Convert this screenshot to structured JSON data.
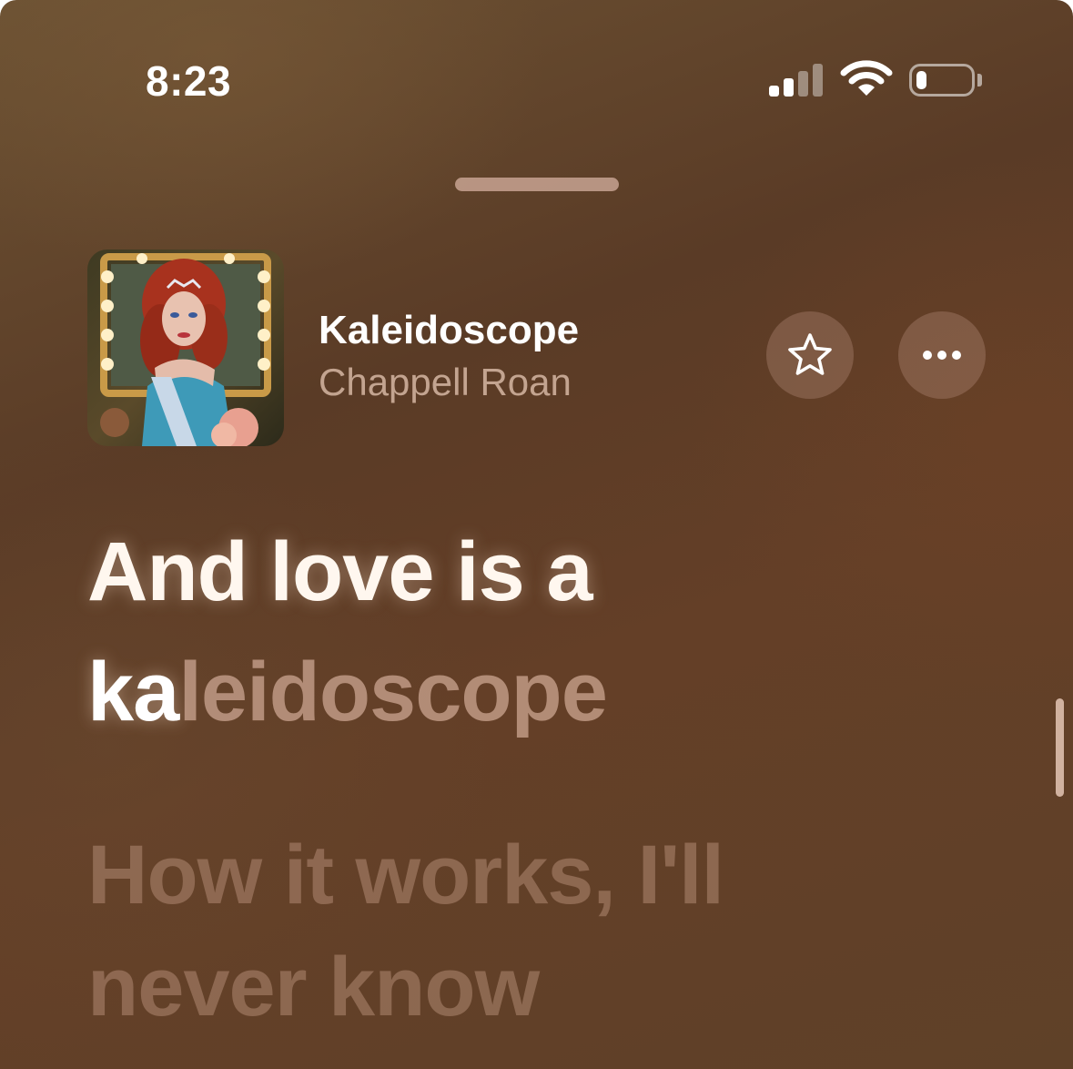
{
  "status_bar": {
    "time": "8:23",
    "signal_bars_active": 2,
    "signal_bars_total": 4,
    "wifi_icon": "wifi-icon",
    "battery_level": 0.2
  },
  "now_playing": {
    "title": "Kaleidoscope",
    "artist": "Chappell Roan",
    "artwork_icon": "album-artwork",
    "favorite_icon": "star-outline-icon",
    "more_icon": "ellipsis-icon"
  },
  "lyrics": {
    "active_line_1": "And love is a",
    "active_line_2_sung": "ka",
    "active_line_2_rest": "leidoscope",
    "next_line_1": "How it works, I'll",
    "next_line_2": "never know"
  },
  "colors": {
    "background": "#5e3f28",
    "accent_text": "#ffffff",
    "dim_text": "#c8a08a"
  }
}
